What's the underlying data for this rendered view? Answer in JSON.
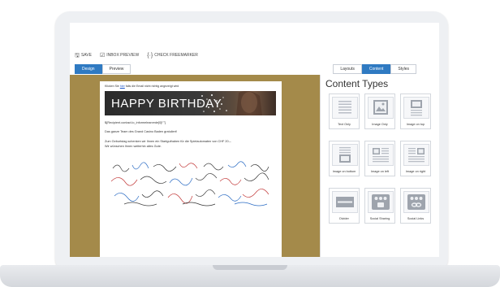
{
  "toolbar": {
    "save_label": "SAVE",
    "inbox_preview_label": "INBOX PREVIEW",
    "check_freemarker_label": "CHECK FREEMARKER"
  },
  "view_tabs": [
    {
      "label": "Design",
      "active": true
    },
    {
      "label": "Preview",
      "active": false
    }
  ],
  "panel_tabs": [
    {
      "label": "Layouts",
      "active": false
    },
    {
      "label": "Content",
      "active": true
    },
    {
      "label": "Styles",
      "active": false
    }
  ],
  "email": {
    "preheader_before": "Klicken Sie ",
    "preheader_link": "hier",
    "preheader_after": " falls die Email nicht richtig angezeigt wird",
    "banner_text": "HAPPY BIRTHDAY",
    "salutation": "${Recipient.contact.lo_informeleanrede[0]!\"\"}",
    "greeting": "Das ganze Team des Grand Casino Baden gratuliert!",
    "body_line1": "Zum Geburtstag schenken wir Ihnen ein Startguthaben für die Spielautomaten von CHF 20.–",
    "body_line2": "Wir wünschen Ihnen weiterhin alles Gute."
  },
  "sidebar": {
    "title": "Content Types",
    "items": [
      {
        "label": "Text Only",
        "icon": "text-only-icon"
      },
      {
        "label": "Image Only",
        "icon": "image-only-icon"
      },
      {
        "label": "Image on top",
        "icon": "image-on-top-icon"
      },
      {
        "label": "Image on bottom",
        "icon": "image-on-bottom-icon"
      },
      {
        "label": "Image on left",
        "icon": "image-on-left-icon"
      },
      {
        "label": "Image on right",
        "icon": "image-on-right-icon"
      },
      {
        "label": "Divider",
        "icon": "divider-icon"
      },
      {
        "label": "Social Sharing",
        "icon": "social-sharing-icon"
      },
      {
        "label": "Social Links",
        "icon": "social-links-icon"
      }
    ]
  },
  "colors": {
    "accent": "#2f7ac2",
    "editor_background": "#a48a4a",
    "banner_background": "#2b2b2b"
  }
}
